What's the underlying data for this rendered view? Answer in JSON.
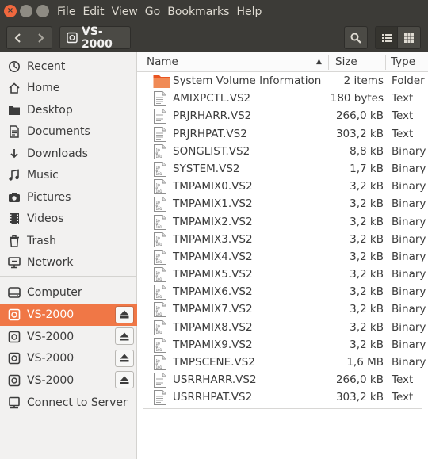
{
  "colors": {
    "accent": "#f07746",
    "header_bg": "#3c3b37",
    "folder": "#e95420"
  },
  "menu": [
    "File",
    "Edit",
    "View",
    "Go",
    "Bookmarks",
    "Help"
  ],
  "toolbar": {
    "path_label": "VS-2000"
  },
  "sidebar": {
    "places": [
      {
        "label": "Recent",
        "icon": "clock-icon"
      },
      {
        "label": "Home",
        "icon": "home-icon"
      },
      {
        "label": "Desktop",
        "icon": "folder-icon"
      },
      {
        "label": "Documents",
        "icon": "document-icon"
      },
      {
        "label": "Downloads",
        "icon": "download-icon"
      },
      {
        "label": "Music",
        "icon": "music-icon"
      },
      {
        "label": "Pictures",
        "icon": "camera-icon"
      },
      {
        "label": "Videos",
        "icon": "film-icon"
      },
      {
        "label": "Trash",
        "icon": "trash-icon"
      },
      {
        "label": "Network",
        "icon": "network-icon"
      }
    ],
    "devices": [
      {
        "label": "Computer",
        "icon": "drive-icon",
        "eject": false,
        "active": false
      },
      {
        "label": "VS-2000",
        "icon": "usb-drive-icon",
        "eject": true,
        "active": true
      },
      {
        "label": "VS-2000",
        "icon": "usb-drive-icon",
        "eject": true,
        "active": false
      },
      {
        "label": "VS-2000",
        "icon": "usb-drive-icon",
        "eject": true,
        "active": false
      },
      {
        "label": "VS-2000",
        "icon": "usb-drive-icon",
        "eject": true,
        "active": false
      },
      {
        "label": "Connect to Server",
        "icon": "server-icon",
        "eject": false,
        "active": false
      }
    ]
  },
  "columns": {
    "name": "Name",
    "size": "Size",
    "type": "Type"
  },
  "files": [
    {
      "name": "System Volume Information",
      "size": "2 items",
      "type": "Folder",
      "kind": "folder"
    },
    {
      "name": "AMIXPCTL.VS2",
      "size": "180 bytes",
      "type": "Text",
      "kind": "text"
    },
    {
      "name": "PRJRHARR.VS2",
      "size": "266,0 kB",
      "type": "Text",
      "kind": "text"
    },
    {
      "name": "PRJRHPAT.VS2",
      "size": "303,2 kB",
      "type": "Text",
      "kind": "text"
    },
    {
      "name": "SONGLIST.VS2",
      "size": "8,8 kB",
      "type": "Binary",
      "kind": "binary"
    },
    {
      "name": "SYSTEM.VS2",
      "size": "1,7 kB",
      "type": "Binary",
      "kind": "binary"
    },
    {
      "name": "TMPAMIX0.VS2",
      "size": "3,2 kB",
      "type": "Binary",
      "kind": "binary"
    },
    {
      "name": "TMPAMIX1.VS2",
      "size": "3,2 kB",
      "type": "Binary",
      "kind": "binary"
    },
    {
      "name": "TMPAMIX2.VS2",
      "size": "3,2 kB",
      "type": "Binary",
      "kind": "binary"
    },
    {
      "name": "TMPAMIX3.VS2",
      "size": "3,2 kB",
      "type": "Binary",
      "kind": "binary"
    },
    {
      "name": "TMPAMIX4.VS2",
      "size": "3,2 kB",
      "type": "Binary",
      "kind": "binary"
    },
    {
      "name": "TMPAMIX5.VS2",
      "size": "3,2 kB",
      "type": "Binary",
      "kind": "binary"
    },
    {
      "name": "TMPAMIX6.VS2",
      "size": "3,2 kB",
      "type": "Binary",
      "kind": "binary"
    },
    {
      "name": "TMPAMIX7.VS2",
      "size": "3,2 kB",
      "type": "Binary",
      "kind": "binary"
    },
    {
      "name": "TMPAMIX8.VS2",
      "size": "3,2 kB",
      "type": "Binary",
      "kind": "binary"
    },
    {
      "name": "TMPAMIX9.VS2",
      "size": "3,2 kB",
      "type": "Binary",
      "kind": "binary"
    },
    {
      "name": "TMPSCENE.VS2",
      "size": "1,6 MB",
      "type": "Binary",
      "kind": "binary"
    },
    {
      "name": "USRRHARR.VS2",
      "size": "266,0 kB",
      "type": "Text",
      "kind": "text"
    },
    {
      "name": "USRRHPAT.VS2",
      "size": "303,2 kB",
      "type": "Text",
      "kind": "text"
    }
  ]
}
